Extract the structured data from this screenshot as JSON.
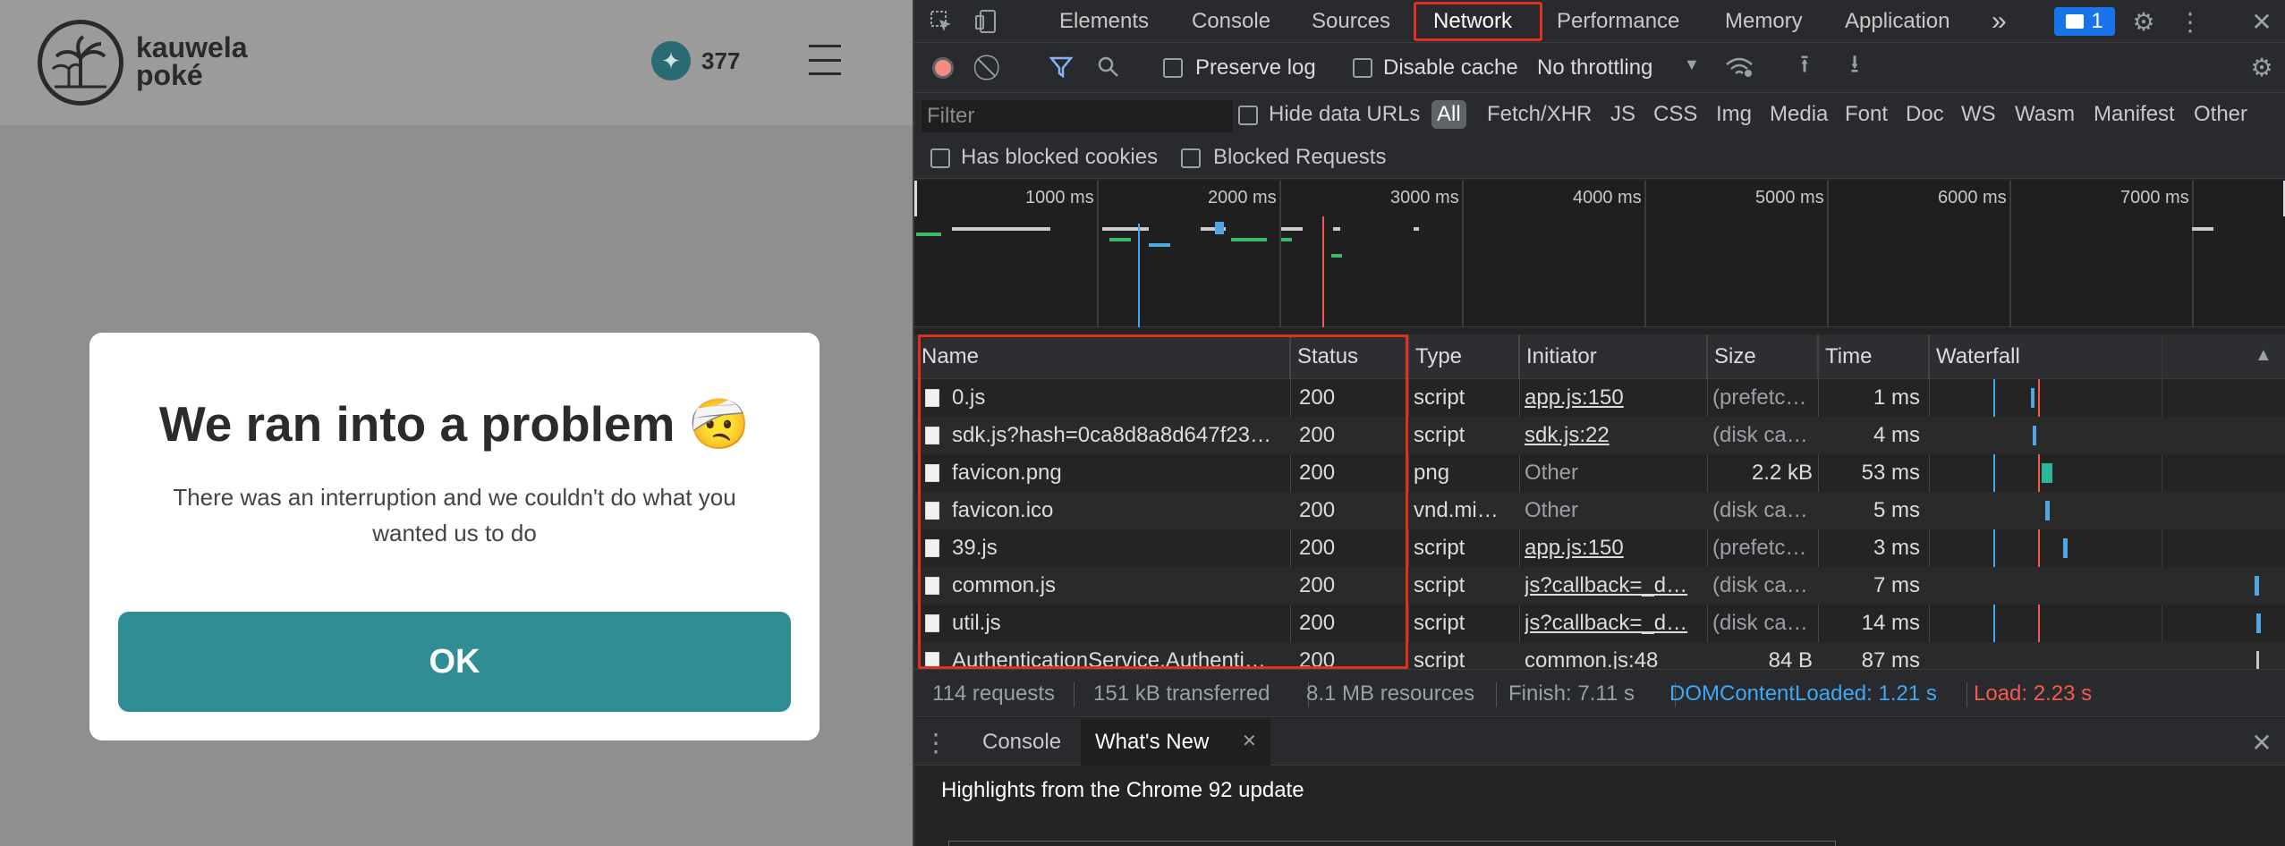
{
  "site": {
    "brand": "kauwela poké",
    "brand_line1": "kauwela",
    "brand_line2": "poké",
    "points_value": "377",
    "modal": {
      "title": "We ran into a problem 🤕",
      "message": "There was an interruption and we couldn't do what you wanted us to do",
      "ok_label": "OK"
    }
  },
  "devtools": {
    "tabs": [
      "Elements",
      "Console",
      "Sources",
      "Network",
      "Performance",
      "Memory",
      "Application"
    ],
    "active_tab": "Network",
    "more_tabs_label": "»",
    "issues_count": "1",
    "toolbar": {
      "preserve_log": "Preserve log",
      "disable_cache": "Disable cache",
      "throttling": "No throttling"
    },
    "filter": {
      "placeholder": "Filter",
      "hide_data_urls": "Hide data URLs",
      "types": [
        "All",
        "Fetch/XHR",
        "JS",
        "CSS",
        "Img",
        "Media",
        "Font",
        "Doc",
        "WS",
        "Wasm",
        "Manifest",
        "Other"
      ],
      "has_blocked_cookies": "Has blocked cookies",
      "blocked_requests": "Blocked Requests"
    },
    "overview_ticks": [
      "1000 ms",
      "2000 ms",
      "3000 ms",
      "4000 ms",
      "5000 ms",
      "6000 ms",
      "7000 ms"
    ],
    "columns": {
      "name": "Name",
      "status": "Status",
      "type": "Type",
      "initiator": "Initiator",
      "size": "Size",
      "time": "Time",
      "waterfall": "Waterfall"
    },
    "rows": [
      {
        "name": "0.js",
        "status": "200",
        "type": "script",
        "initiator": "app.js:150",
        "initiator_link": true,
        "size": "(prefetc…",
        "time": "1 ms"
      },
      {
        "name": "sdk.js?hash=0ca8d8a8d647f23…",
        "status": "200",
        "type": "script",
        "initiator": "sdk.js:22",
        "initiator_link": true,
        "size": "(disk ca…",
        "time": "4 ms"
      },
      {
        "name": "favicon.png",
        "status": "200",
        "type": "png",
        "initiator": "Other",
        "initiator_link": false,
        "size": "2.2 kB",
        "time": "53 ms"
      },
      {
        "name": "favicon.ico",
        "status": "200",
        "type": "vnd.mi…",
        "initiator": "Other",
        "initiator_link": false,
        "size": "(disk ca…",
        "time": "5 ms"
      },
      {
        "name": "39.js",
        "status": "200",
        "type": "script",
        "initiator": "app.js:150",
        "initiator_link": true,
        "size": "(prefetc…",
        "time": "3 ms"
      },
      {
        "name": "common.js",
        "status": "200",
        "type": "script",
        "initiator": "js?callback=_d…",
        "initiator_link": true,
        "size": "(disk ca…",
        "time": "7 ms"
      },
      {
        "name": "util.js",
        "status": "200",
        "type": "script",
        "initiator": "js?callback=_d…",
        "initiator_link": true,
        "size": "(disk ca…",
        "time": "14 ms"
      },
      {
        "name": "AuthenticationService.Authenti…",
        "status": "200",
        "type": "script",
        "initiator": "common.js:48",
        "initiator_link": true,
        "size": "84 B",
        "time": "87 ms"
      }
    ],
    "status": {
      "requests": "114 requests",
      "transferred": "151 kB transferred",
      "resources": "8.1 MB resources",
      "finish": "Finish: 7.11 s",
      "dcl": "DOMContentLoaded: 1.21 s",
      "load": "Load: 2.23 s"
    },
    "drawer": {
      "tabs": [
        "Console",
        "What's New"
      ],
      "active_tab": "What's New",
      "highlights": "Highlights from the Chrome 92 update"
    },
    "colors": {
      "dcl": "#3ea8f5",
      "load": "#f55a4e",
      "highlight": "#e0301e"
    }
  }
}
